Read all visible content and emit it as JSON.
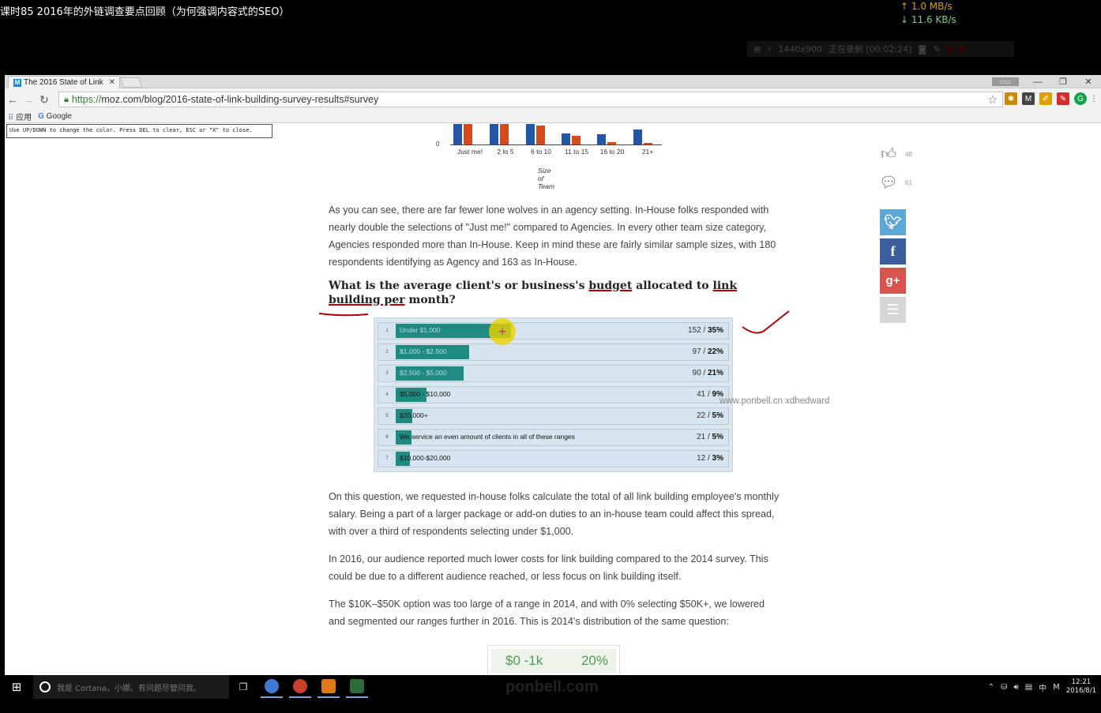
{
  "recording": {
    "title": "课时85 2016年的外链调查要点回顾（为何强调内容式的SEO）",
    "net_up": "↑ 1.0 MB/s",
    "net_down": "↓ 11.6 KB/s",
    "resolution": "1440x900",
    "status": "正在录制 [00:02:24]"
  },
  "browser": {
    "tab_title": "The 2016 State of Link",
    "url_scheme": "https://",
    "url_rest": "moz.com/blog/2016-state-of-link-building-survey-results#survey",
    "bookmarks": {
      "apps": "应用",
      "google": "Google"
    },
    "hint": "Use UP/DOWN to change the color. Press DEL to clear, ESC or \"X\" to close."
  },
  "team_chart": {
    "zero_label": "0",
    "x_title": "Size of Team",
    "categories": [
      "Just me!",
      "2 to 5",
      "6 to 10",
      "11 to 15",
      "16 to 20",
      "21+"
    ]
  },
  "chart_data": {
    "type": "bar",
    "title": "What is the average client's or business's budget allocated to link building per month?",
    "categories": [
      "Under $1,000",
      "$1,000 - $2,500",
      "$2,500 - $5,000",
      "$5,000 - $10,000",
      "$20,000+",
      "We service an even amount of clients in all of these ranges",
      "$10,000-$20,000"
    ],
    "series": [
      {
        "name": "",
        "values": [
          152,
          97,
          90,
          41,
          22,
          21,
          12
        ]
      }
    ],
    "percents": [
      "35%",
      "22%",
      "21%",
      "9%",
      "5%",
      "5%",
      "3%"
    ]
  },
  "article": {
    "p1": "As you can see, there are far fewer lone wolves in an agency setting. In-House folks responded with nearly double the selections of \"Just me!\" compared to Agencies. In every other team size category, Agencies responded more than In-House. Keep in mind these are fairly similar sample sizes, with 180 respondents identifying as Agency and 163 as In-House.",
    "q_part1": "What is the average client's or business's ",
    "q_budget": "budget",
    "q_part2": " allocated to ",
    "q_link": "link building per",
    "q_month": "month?",
    "p2": "On this question, we requested in-house folks calculate the total of all link building employee's monthly salary. Being a part of a larger package or add-on duties to an in-house team could affect this spread, with over a third of respondents selecting under $1,000.",
    "p3": "In 2016, our audience reported much lower costs for link building compared to the 2014 survey. This could be due to a different audience reached, or less focus on link building itself.",
    "p4": "The $10K–$50K option was too large of a range in 2014, and with 0% selecting $50K+, we lowered and segmented our ranges further in 2016. This is 2014's distribution of the same question:"
  },
  "rows": [
    {
      "num": "1",
      "label": "Under $1,000",
      "count": "152 / ",
      "pct": "35%"
    },
    {
      "num": "2",
      "label": "$1,000 - $2,500",
      "count": "97 / ",
      "pct": "22%"
    },
    {
      "num": "3",
      "label": "$2,500 - $5,000",
      "count": "90 / ",
      "pct": "21%"
    },
    {
      "num": "4",
      "label": "$5,000 - $10,000",
      "count": "41 / ",
      "pct": "9%"
    },
    {
      "num": "5",
      "label": "$20,000+",
      "count": "22 / ",
      "pct": "5%"
    },
    {
      "num": "6",
      "label": "We service an even amount of clients in all of these ranges",
      "count": "21 / ",
      "pct": "5%"
    },
    {
      "num": "7",
      "label": "$10,000-$20,000",
      "count": "12 / ",
      "pct": "3%"
    }
  ],
  "watermark": "www.ponbell.cn xdhedward",
  "sidebar": {
    "likes": "48",
    "comments": "61"
  },
  "mini_table": {
    "range": "$0 -1k",
    "pct": "20%"
  },
  "taskbar": {
    "cortana": "我是 Cortana，小娜。有问题尽管问我。",
    "brand": "ponbell.com",
    "ime": "中",
    "time": "12:21",
    "date": "2016/8/1"
  },
  "colors": {
    "bar_teal": "#1f8a80",
    "team_blue": "#2456a8",
    "team_orange": "#d64a1c",
    "ink_red": "#b00000"
  }
}
